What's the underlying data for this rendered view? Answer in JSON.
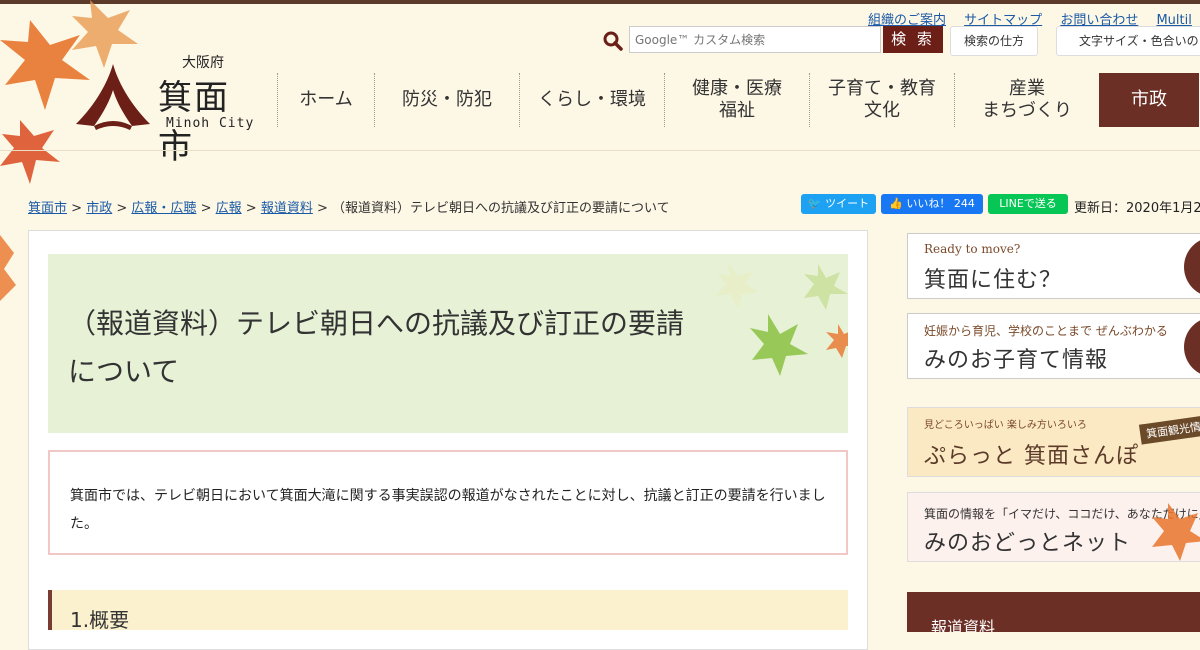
{
  "utility_links": [
    "組織のご案内",
    "サイトマップ",
    "お問い合わせ",
    "Multil"
  ],
  "search": {
    "placeholder": "Google™ カスタム検索",
    "button": "検 索",
    "howto": "検索の仕方"
  },
  "accessibility_button": "文字サイズ・色合いの",
  "logo": {
    "prefecture": "大阪府",
    "city": "箕面市",
    "english": "Minoh City"
  },
  "global_nav": [
    {
      "label": "ホーム"
    },
    {
      "label": "防災・防犯"
    },
    {
      "label": "くらし・環境"
    },
    {
      "label": "健康・医療\n福祉"
    },
    {
      "label": "子育て・教育\n文化"
    },
    {
      "label": "産業\nまちづくり"
    },
    {
      "label": "市政"
    }
  ],
  "breadcrumb": {
    "items": [
      "箕面市",
      "市政",
      "広報・広聴",
      "広報",
      "報道資料"
    ],
    "separator": ">",
    "current": "（報道資料）テレビ朝日への抗議及び訂正の要請について"
  },
  "share": {
    "tweet": "ツイート",
    "like": "いいね！ 244",
    "line": "LINEで送る"
  },
  "updated": "更新日：2020年1月2",
  "main": {
    "title": "（報道資料）テレビ朝日への抗議及び訂正の要請について",
    "intro": "箕面市では、テレビ朝日において箕面大滝に関する事実誤認の報道がなされたことに対し、抗議と訂正の要請を行いました。",
    "section1": "1.概要"
  },
  "side_banners": [
    {
      "small": "Ready to move?",
      "big": "箕面に住む？"
    },
    {
      "small": "妊娠から育児、学校のことまで ぜんぶわかる",
      "big": "みのお子育て情報"
    },
    {
      "small": "見どころいっぱい 楽しみ方いろいろ",
      "big": "ぷらっと 箕面さんぽ",
      "tag": "箕面観光情"
    },
    {
      "small": "箕面の情報を「イマだけ、ココだけ、あなただけに」",
      "big": "みのおどっとネット"
    },
    {
      "heading": "報道資料"
    }
  ],
  "colors": {
    "brand": "#6b2f26",
    "link": "#1a5aa6",
    "title_bg": "#e6f1d6",
    "page_bg": "#fdf7e6"
  }
}
